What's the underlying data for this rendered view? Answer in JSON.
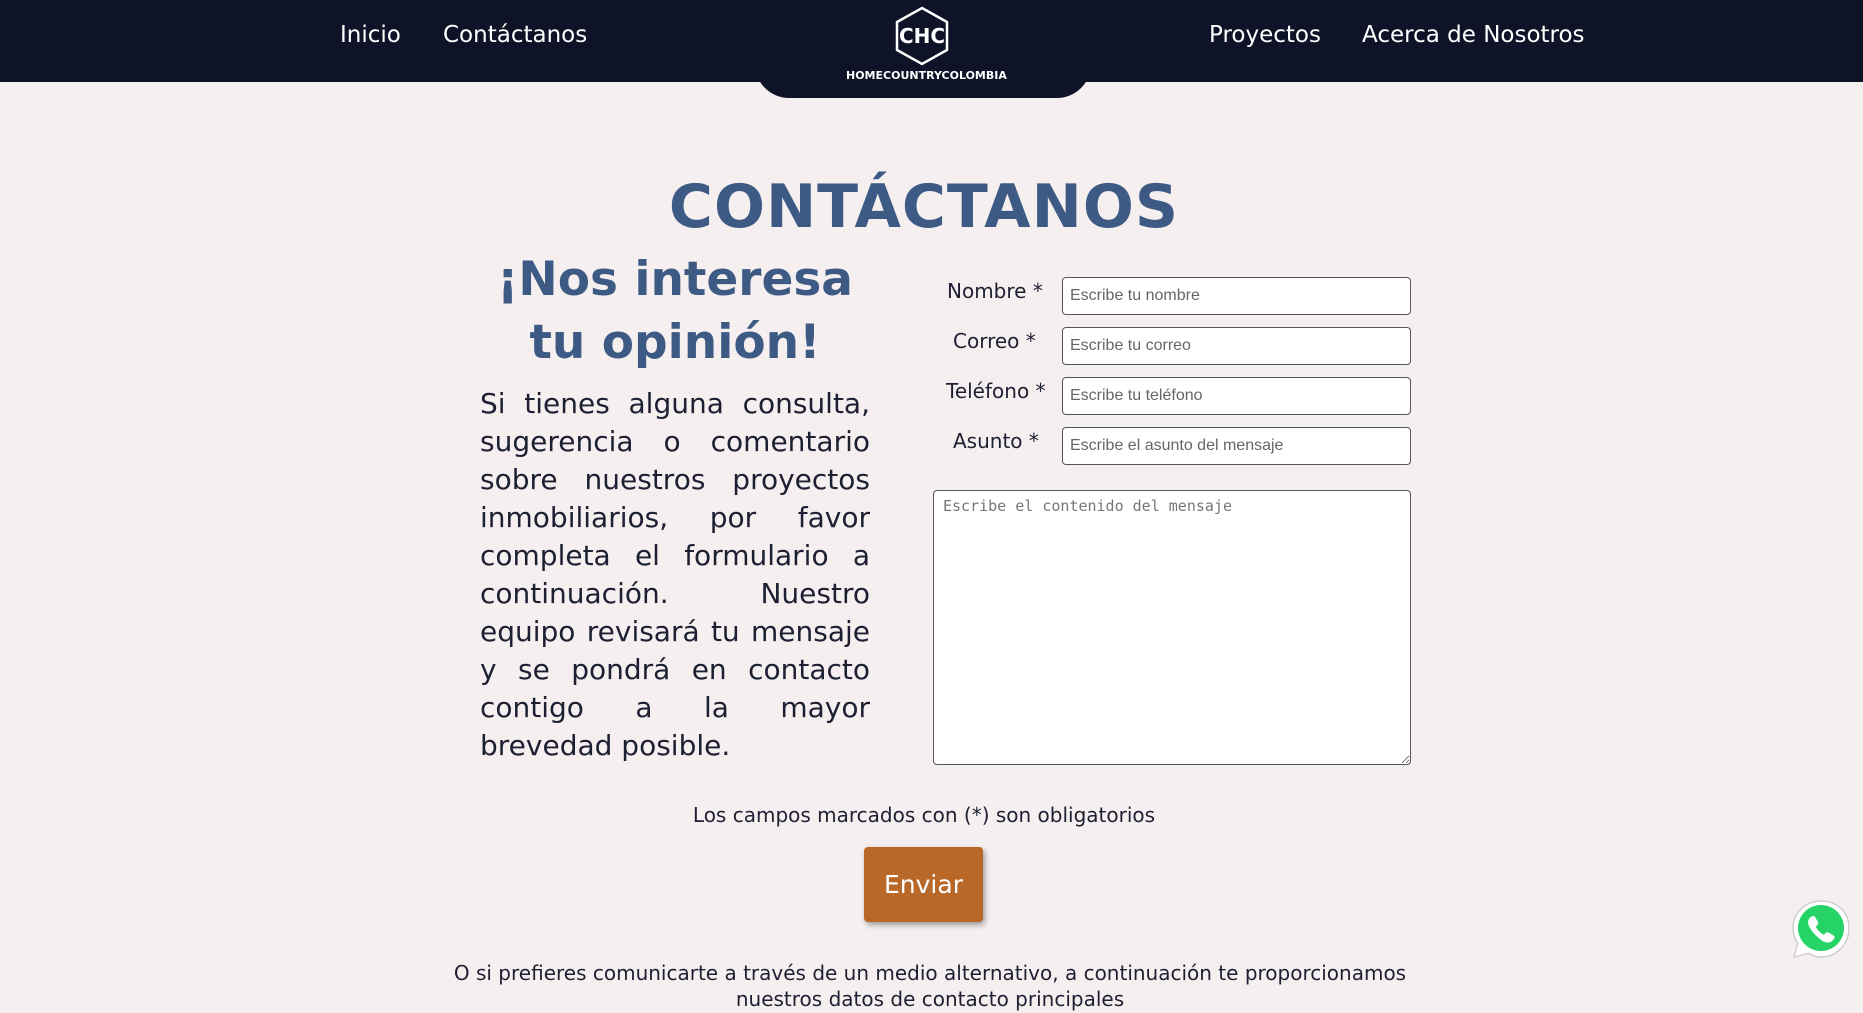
{
  "header": {
    "nav_left": [
      "Inicio",
      "Contáctanos"
    ],
    "nav_right": [
      "Proyectos",
      "Acerca de Nosotros"
    ],
    "logo_text": "HOMECOUNTRYCOLOMBIA"
  },
  "main": {
    "title": "CONTÁCTANOS",
    "subtitle": "¡Nos interesa tu opinión!",
    "intro": "Si tienes alguna consulta, sugerencia o comentario sobre nuestros proyectos inmobiliarios, por favor completa el formulario a continuación. Nuestro equipo revisará tu mensaje y se pondrá en contacto contigo a la mayor brevedad posible."
  },
  "form": {
    "name_label": "Nombre *",
    "name_placeholder": "Escribe tu nombre",
    "email_label": "Correo *",
    "email_placeholder": "Escribe tu correo",
    "phone_label": "Teléfono *",
    "phone_placeholder": "Escribe tu teléfono",
    "subject_label": "Asunto *",
    "subject_placeholder": "Escribe el asunto del mensaje",
    "message_placeholder": "Escribe el contenido del mensaje",
    "required_note": "Los campos marcados con (*) son obligatorios",
    "submit_label": "Enviar"
  },
  "footer": {
    "alt_contact": "O si prefieres comunicarte a través de un medio alternativo, a continuación te proporcionamos nuestros datos de contacto principales"
  },
  "colors": {
    "header_bg": "#0f1328",
    "page_bg": "#f5efef",
    "title_blue": "#3d5a85",
    "button_orange": "#b8692a",
    "whatsapp_green": "#25d366"
  },
  "icons": {
    "logo": "hexagon-chc-logo-icon",
    "whatsapp": "whatsapp-icon"
  }
}
